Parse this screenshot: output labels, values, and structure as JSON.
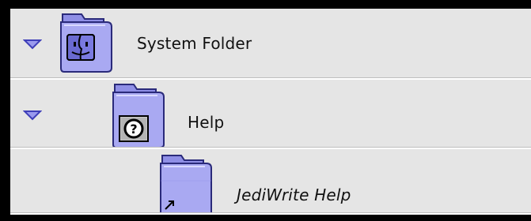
{
  "finder_list": {
    "rows": [
      {
        "label": "System Folder",
        "expanded": true,
        "icon": "system-folder-icon"
      },
      {
        "label": "Help",
        "expanded": true,
        "icon": "help-folder-icon"
      },
      {
        "label": "JediWrite Help",
        "expanded": false,
        "icon": "alias-folder-icon",
        "is_alias": true
      }
    ]
  },
  "colors": {
    "row_background": "#e5e5e5",
    "folder_fill": "#a9a9f2",
    "folder_dark": "#5b5bd6",
    "triangle": "#4d4dc9"
  }
}
